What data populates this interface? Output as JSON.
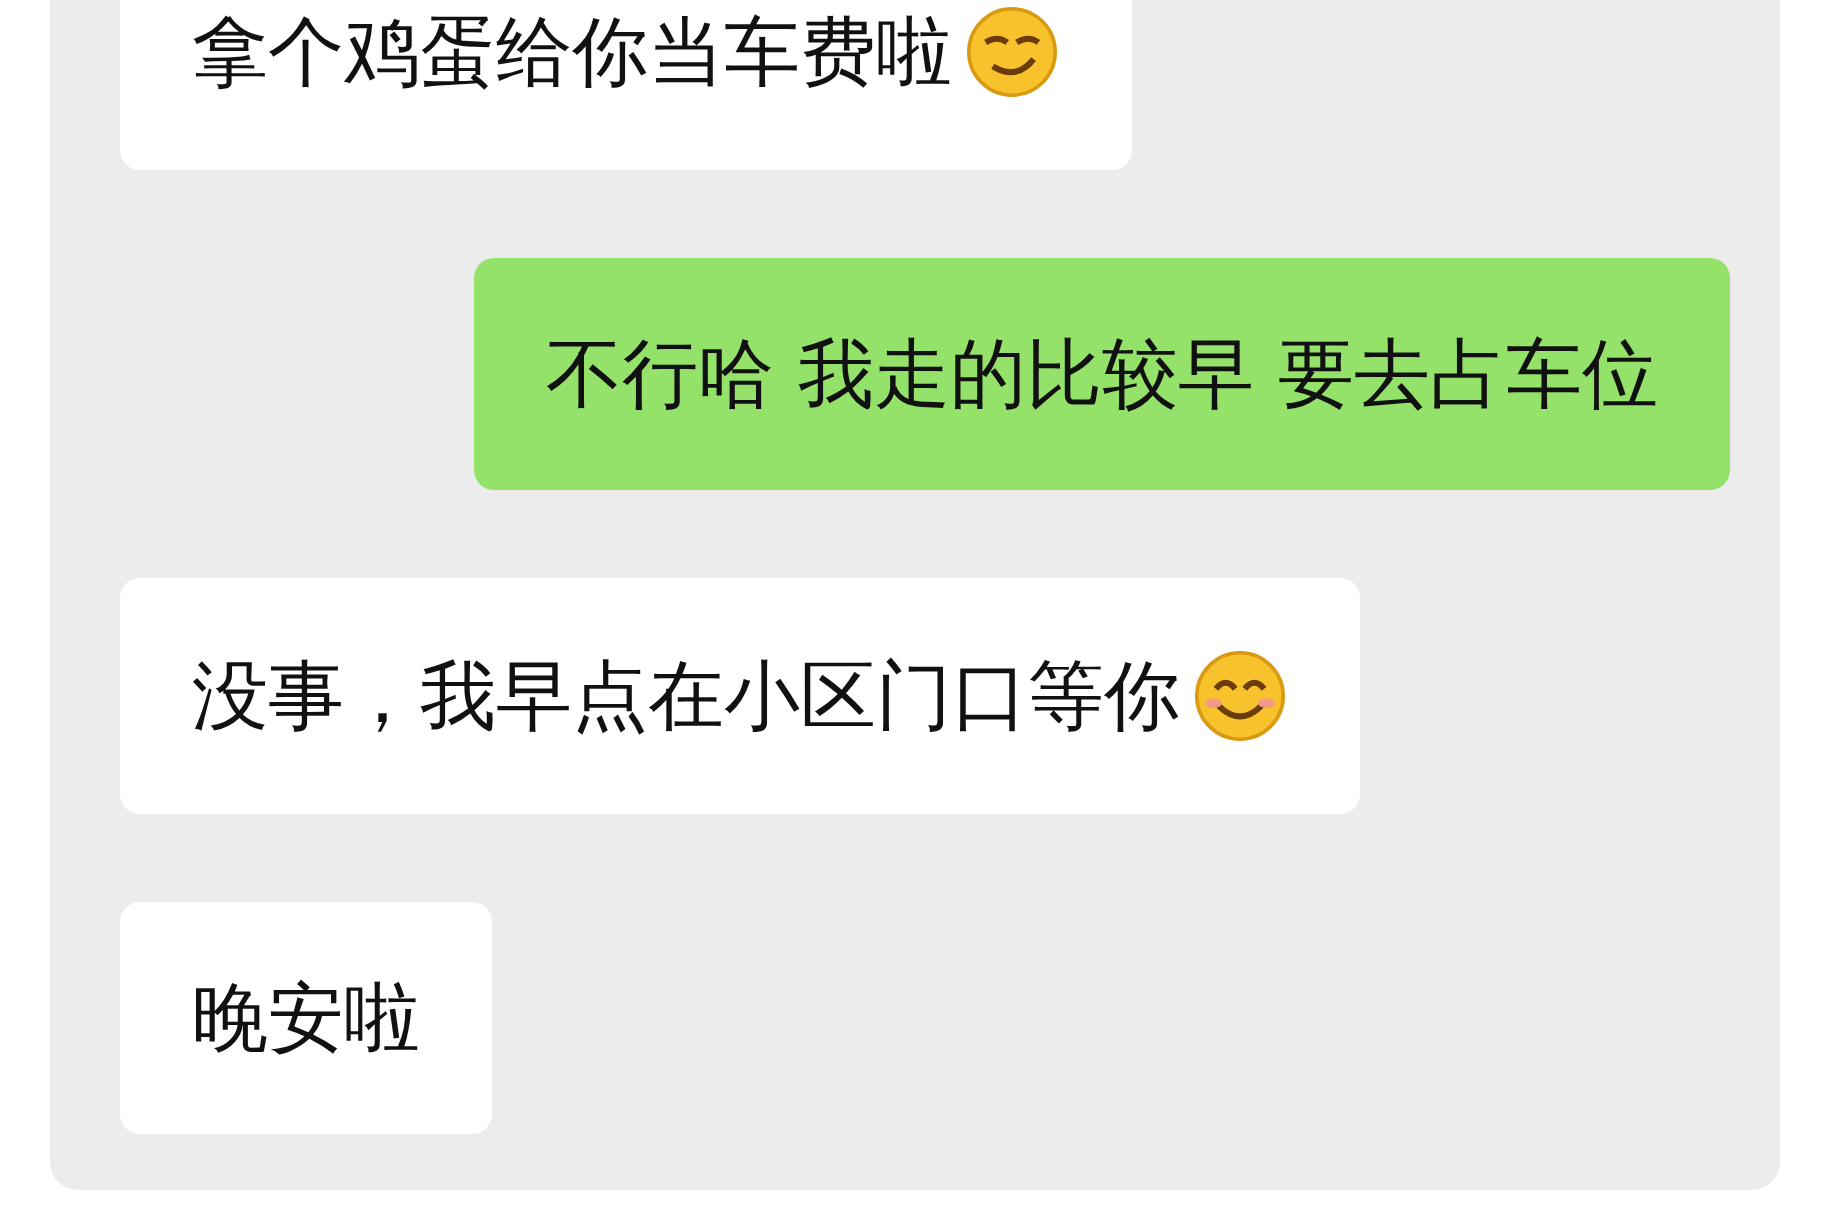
{
  "messages": [
    {
      "kind": "received",
      "text": "拿个鸡蛋给你当车费啦",
      "emoji": {
        "kind": "smirk"
      }
    },
    {
      "kind": "sent",
      "text": "不行哈 我走的比较早 要去占车位"
    },
    {
      "kind": "received",
      "text": "没事，我早点在小区门口等你",
      "emoji": {
        "kind": "smile"
      }
    },
    {
      "kind": "received",
      "text": "晚安啦"
    }
  ]
}
